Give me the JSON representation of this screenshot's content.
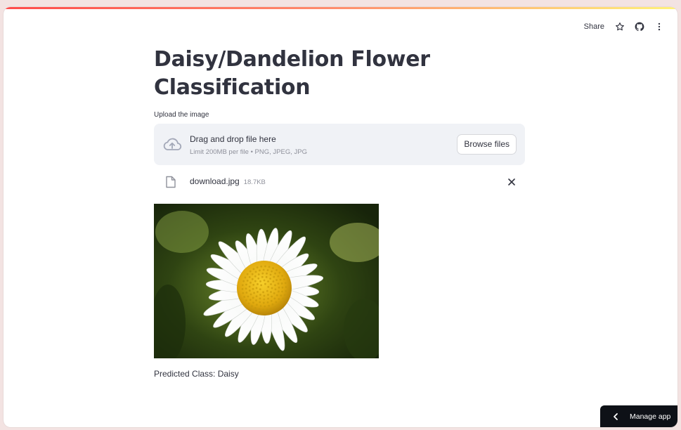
{
  "header": {
    "share_label": "Share",
    "icons": [
      "star-icon",
      "github-icon",
      "more-vertical-icon"
    ]
  },
  "main": {
    "title": "Daisy/Dandelion Flower Classification",
    "uploader": {
      "label": "Upload the image",
      "drop_text": "Drag and drop file here",
      "limit_text": "Limit 200MB per file • PNG, JPEG, JPG",
      "browse_label": "Browse files"
    },
    "file": {
      "name": "download.jpg",
      "size": "18.7KB"
    },
    "prediction": "Predicted Class: Daisy"
  },
  "footer": {
    "manage_label": "Manage app"
  },
  "colors": {
    "accent_gradient_start": "#ff4b4b",
    "accent_gradient_end": "#fff27a",
    "text": "#31333f",
    "dropzone_bg": "#f0f2f6",
    "manage_bg": "#0e1117"
  }
}
